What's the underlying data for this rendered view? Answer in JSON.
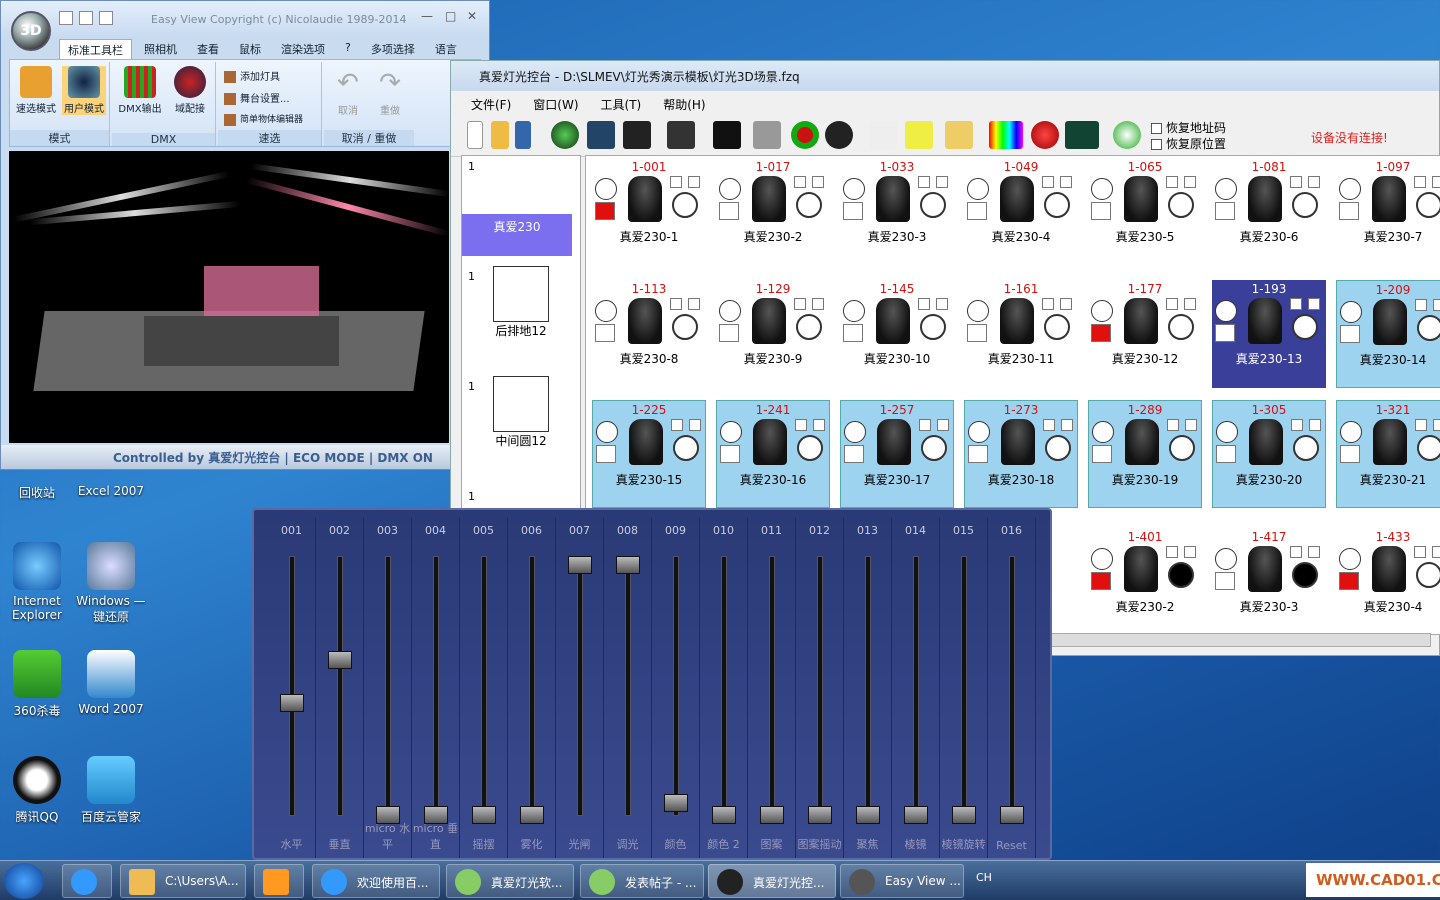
{
  "desktop": {
    "icons": [
      {
        "label": "回收站",
        "x": 0
      },
      {
        "label": "Excel 2007"
      },
      {
        "label": "Internet Explorer"
      },
      {
        "label": "Windows —键还原"
      },
      {
        "label": "360杀毒"
      },
      {
        "label": "Word 2007"
      },
      {
        "label": "腾讯QQ"
      },
      {
        "label": "百度云管家"
      }
    ]
  },
  "easyview": {
    "orb": "3D",
    "title": "Easy View   Copyright (c) Nicolaudie 1989-2014",
    "min": "—",
    "max": "□",
    "close": "✕",
    "tabs": [
      "标准工具栏",
      "照相机",
      "查看",
      "鼠标",
      "渲染选项",
      "?",
      "多项选择",
      "语言"
    ],
    "groups": {
      "mode": "模式",
      "dmx": "DMX",
      "quick": "速选",
      "undo": "取消 / 重做"
    },
    "buttons": {
      "quick_mode": "速选模式",
      "user_mode": "用户模式",
      "dmx_out": "DMX输出",
      "dmx_match": "域配接",
      "add_fixture": "添加灯具",
      "stage_setup": "舞台设置...",
      "simple_editor": "简单物体编辑器",
      "undo": "取消",
      "redo": "重做"
    },
    "status": "Controlled by 真爱灯光控台  |  ECO MODE  |  DMX ON"
  },
  "main": {
    "title": "真爱灯光控台 - D:\\SLMEV\\灯光秀演示模板\\灯光3D场景.fzq",
    "menu": [
      "文件(F)",
      "窗口(W)",
      "工具(T)",
      "帮助(H)"
    ],
    "chk1": "恢复地址码",
    "chk2": "恢复原位置",
    "warning": "设备没有连接!",
    "library": [
      {
        "n": "1",
        "name": "真爱230"
      },
      {
        "n": "1",
        "name": "后排地12"
      },
      {
        "n": "1",
        "name": "中间圆12"
      },
      {
        "n": "1",
        "name": ""
      }
    ],
    "fixtures": [
      {
        "addr": "1-001",
        "name": "真爱230-1"
      },
      {
        "addr": "1-017",
        "name": "真爱230-2"
      },
      {
        "addr": "1-033",
        "name": "真爱230-3"
      },
      {
        "addr": "1-049",
        "name": "真爱230-4"
      },
      {
        "addr": "1-065",
        "name": "真爱230-5"
      },
      {
        "addr": "1-081",
        "name": "真爱230-6"
      },
      {
        "addr": "1-097",
        "name": "真爱230-7"
      },
      {
        "addr": "1-113",
        "name": "真爱230-8"
      },
      {
        "addr": "1-129",
        "name": "真爱230-9"
      },
      {
        "addr": "1-145",
        "name": "真爱230-10"
      },
      {
        "addr": "1-161",
        "name": "真爱230-11"
      },
      {
        "addr": "1-177",
        "name": "真爱230-12"
      },
      {
        "addr": "1-193",
        "name": "真爱230-13"
      },
      {
        "addr": "1-209",
        "name": "真爱230-14"
      },
      {
        "addr": "1-225",
        "name": "真爱230-15"
      },
      {
        "addr": "1-241",
        "name": "真爱230-16"
      },
      {
        "addr": "1-257",
        "name": "真爱230-17"
      },
      {
        "addr": "1-273",
        "name": "真爱230-18"
      },
      {
        "addr": "1-289",
        "name": "真爱230-19"
      },
      {
        "addr": "1-305",
        "name": "真爱230-20"
      },
      {
        "addr": "1-321",
        "name": "真爱230-21"
      },
      {
        "addr": "1-401",
        "name": "真爱230-2"
      },
      {
        "addr": "1-417",
        "name": "真爱230-3"
      },
      {
        "addr": "1-433",
        "name": "真爱230-4"
      }
    ]
  },
  "faders": [
    {
      "num": "001",
      "label": "水平",
      "level": 0.45
    },
    {
      "num": "002",
      "label": "垂直",
      "level": 0.62
    },
    {
      "num": "003",
      "label": "micro 水平",
      "level": 0
    },
    {
      "num": "004",
      "label": "micro 垂直",
      "level": 0
    },
    {
      "num": "005",
      "label": "摇摆",
      "level": 0
    },
    {
      "num": "006",
      "label": "雾化",
      "level": 0
    },
    {
      "num": "007",
      "label": "光闸",
      "level": 1
    },
    {
      "num": "008",
      "label": "调光",
      "level": 1
    },
    {
      "num": "009",
      "label": "颜色",
      "level": 0.05
    },
    {
      "num": "010",
      "label": "颜色 2",
      "level": 0
    },
    {
      "num": "011",
      "label": "图案",
      "level": 0
    },
    {
      "num": "012",
      "label": "图案摇动",
      "level": 0
    },
    {
      "num": "013",
      "label": "聚焦",
      "level": 0
    },
    {
      "num": "014",
      "label": "棱镜",
      "level": 0
    },
    {
      "num": "015",
      "label": "棱镜旋转",
      "level": 0
    },
    {
      "num": "016",
      "label": "Reset",
      "level": 0
    }
  ],
  "taskbar": {
    "items": [
      "C:\\Users\\A...",
      "欢迎使用百...",
      "真爱灯光软...",
      "发表帖子 - ...",
      "真爱灯光控...",
      "Easy View ..."
    ],
    "lang": "CH",
    "watermark": "WWW.CAD01.COM"
  }
}
